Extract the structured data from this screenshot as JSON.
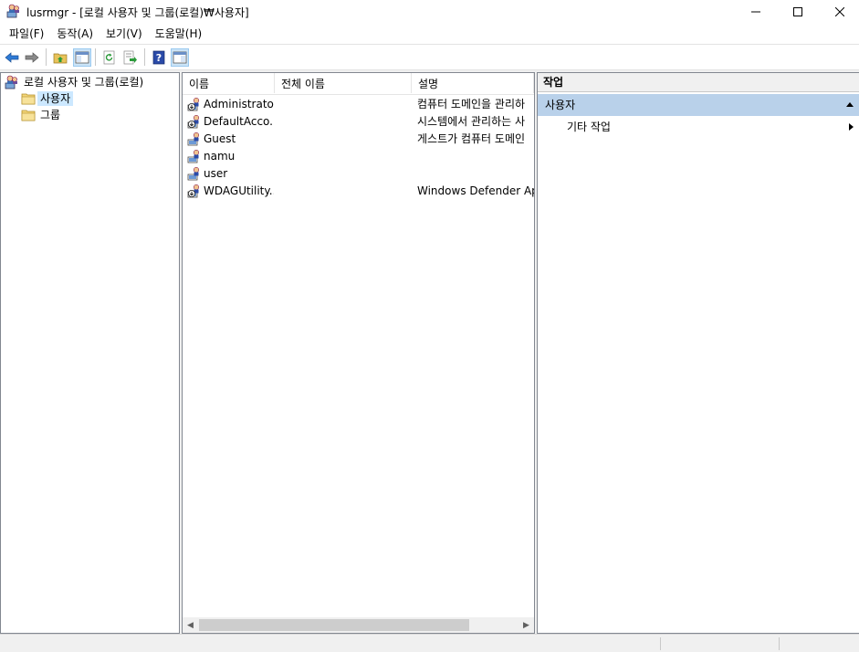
{
  "window": {
    "title": "lusrmgr - [로컬 사용자 및 그룹(로컬)₩사용자]",
    "icon": "users-computer-icon"
  },
  "menu": [
    {
      "label": "파일(F)"
    },
    {
      "label": "동작(A)"
    },
    {
      "label": "보기(V)"
    },
    {
      "label": "도움말(H)"
    }
  ],
  "toolbar": {
    "buttons": [
      "back-arrow-icon",
      "forward-arrow-icon",
      "up-folder-icon",
      "show-hide-console-tree-icon",
      "refresh-icon",
      "export-list-icon",
      "help-icon",
      "show-hide-action-pane-icon"
    ]
  },
  "tree": {
    "root": "로컬 사용자 및 그룹(로컬)",
    "children": [
      {
        "label": "사용자",
        "selected": true
      },
      {
        "label": "그룹",
        "selected": false
      }
    ]
  },
  "list": {
    "columns": [
      "이름",
      "전체 이름",
      "설명"
    ],
    "rows": [
      {
        "name": "Administrator",
        "full_name": "",
        "description": "컴퓨터 도메인을 관리하",
        "icon": "disabled-user-icon"
      },
      {
        "name": "DefaultAcco...",
        "full_name": "",
        "description": "시스템에서 관리하는 사",
        "icon": "disabled-user-icon"
      },
      {
        "name": "Guest",
        "full_name": "",
        "description": "게스트가 컴퓨터 도메인",
        "icon": "user-icon"
      },
      {
        "name": "namu",
        "full_name": "",
        "description": "",
        "icon": "user-icon"
      },
      {
        "name": "user",
        "full_name": "",
        "description": "",
        "icon": "user-icon"
      },
      {
        "name": "WDAGUtility...",
        "full_name": "",
        "description": "Windows Defender App",
        "icon": "disabled-user-icon"
      }
    ]
  },
  "actions": {
    "header": "작업",
    "section": "사용자",
    "items": [
      {
        "label": "기타 작업"
      }
    ]
  },
  "colors": {
    "selection": "#cce8ff",
    "actions_section": "#b9d1ea"
  }
}
